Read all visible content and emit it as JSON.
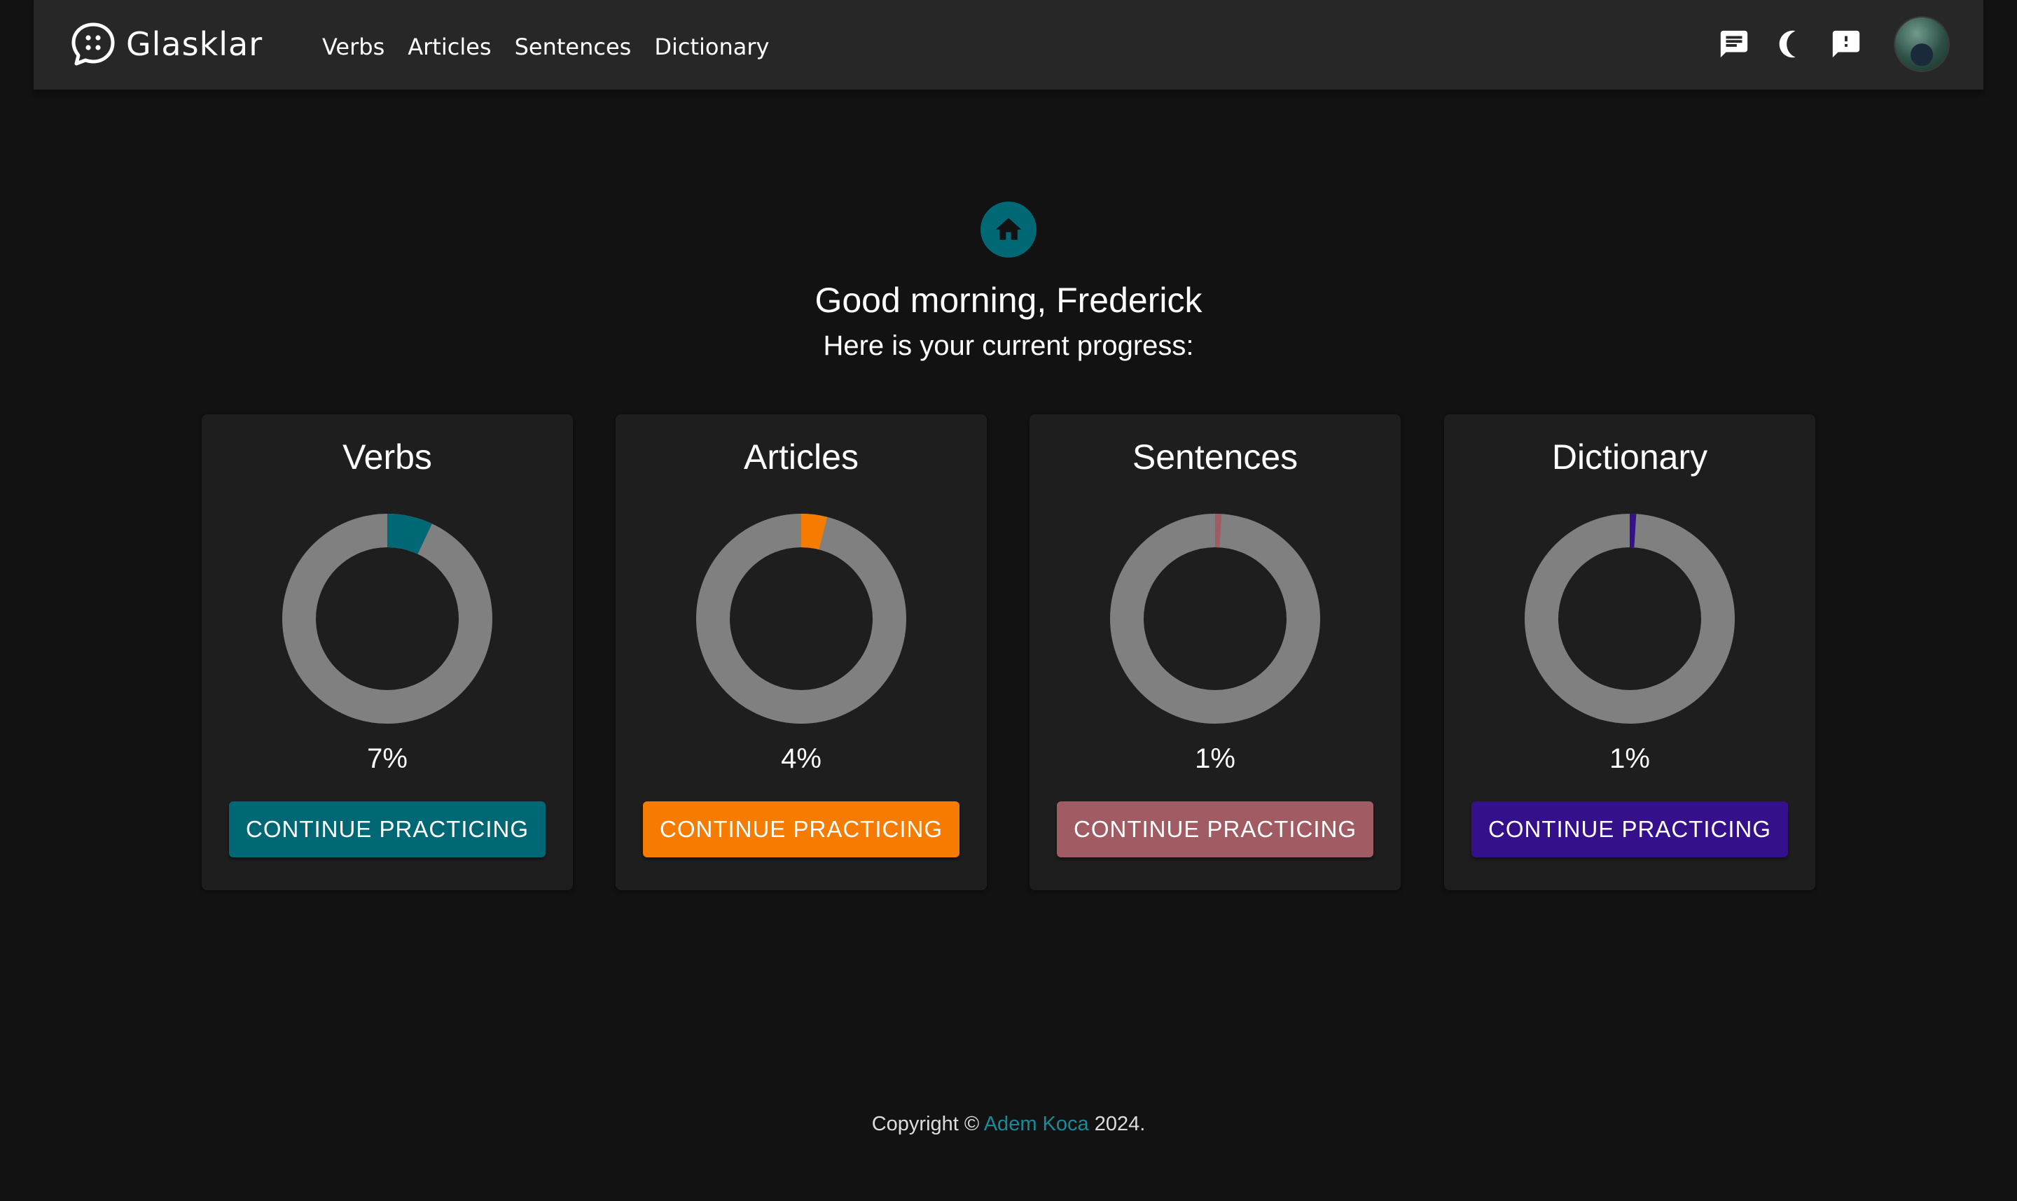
{
  "app": {
    "name": "Glasklar"
  },
  "nav": {
    "links": [
      "Verbs",
      "Articles",
      "Sentences",
      "Dictionary"
    ],
    "actions": [
      "chat-icon",
      "dark-mode-moon-icon",
      "feedback-icon",
      "user-avatar"
    ]
  },
  "hero": {
    "icon": "home-icon",
    "greeting": "Good morning, Frederick",
    "subtitle": "Here is your current progress:"
  },
  "cards": [
    {
      "title": "Verbs",
      "percent_label": "7%",
      "progress": 7,
      "button": "CONTINUE PRACTICING",
      "color": "#006875"
    },
    {
      "title": "Articles",
      "percent_label": "4%",
      "progress": 4,
      "button": "CONTINUE PRACTICING",
      "color": "#F57C00"
    },
    {
      "title": "Sentences",
      "percent_label": "1%",
      "progress": 1,
      "button": "CONTINUE PRACTICING",
      "color": "#A05C62"
    },
    {
      "title": "Dictionary",
      "percent_label": "1%",
      "progress": 1,
      "button": "CONTINUE PRACTICING",
      "color": "#34108A"
    }
  ],
  "donut_track_color": "#808080",
  "footer": {
    "prefix": "Copyright © ",
    "author": "Adem Koca",
    "suffix": " 2024."
  }
}
